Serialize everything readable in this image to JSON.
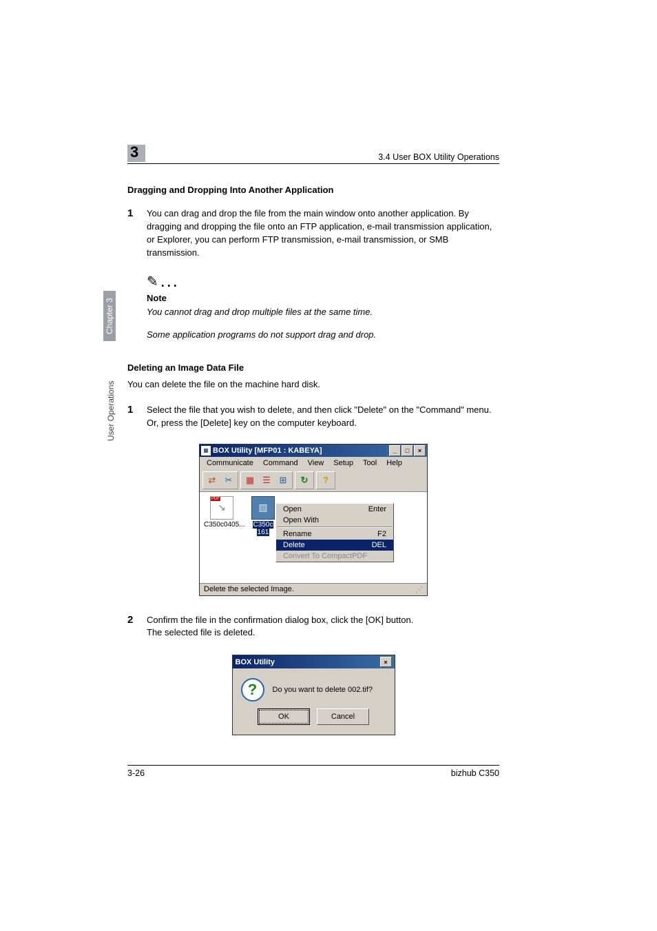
{
  "header": {
    "chapter_number": "3",
    "breadcrumb": "3.4 User BOX Utility Operations"
  },
  "sidebar": {
    "vertical_label": "User Operations",
    "chapter_chip": "Chapter 3"
  },
  "section1": {
    "heading": "Dragging and Dropping Into Another Application",
    "step1_num": "1",
    "step1_text": "You can drag and drop the file from the main window onto another application. By dragging and dropping the file onto an FTP application, e-mail transmission application, or Explorer, you can perform FTP transmission, e-mail transmission, or SMB transmission."
  },
  "note": {
    "label": "Note",
    "text1": "You cannot drag and drop multiple files at the same time.",
    "text2": "Some application programs do not support drag and drop."
  },
  "section2": {
    "heading": "Deleting an Image Data File",
    "intro": "You can delete the file on the machine hard disk.",
    "step1_num": "1",
    "step1_text1": "Select the file that you wish to delete, and then click \"Delete\" on the \"Command\" menu.",
    "step1_text2": "Or, press the [Delete] key on the computer keyboard.",
    "step2_num": "2",
    "step2_text1": "Confirm the file in the confirmation dialog box, click the [OK] button.",
    "step2_text2": "The selected file is deleted."
  },
  "win1": {
    "title": "BOX Utility  [MFP01 : KABEYA]",
    "menus": {
      "communicate": "Communicate",
      "command": "Command",
      "view": "View",
      "setup": "Setup",
      "tool": "Tool",
      "help": "Help"
    },
    "file1_label": "C350c0405...",
    "file2_label_a": "C350c",
    "file2_label_b": "161",
    "context": {
      "open": "Open",
      "open_shortcut": "Enter",
      "open_with": "Open With",
      "rename": "Rename",
      "rename_shortcut": "F2",
      "delete": "Delete",
      "delete_shortcut": "DEL",
      "convert": "Convert To CompactPDF"
    },
    "status": "Delete the selected Image."
  },
  "dialog": {
    "title": "BOX Utility",
    "message": "Do you want to delete 002.tif?",
    "ok": "OK",
    "cancel": "Cancel"
  },
  "footer": {
    "page": "3-26",
    "model": "bizhub C350"
  }
}
